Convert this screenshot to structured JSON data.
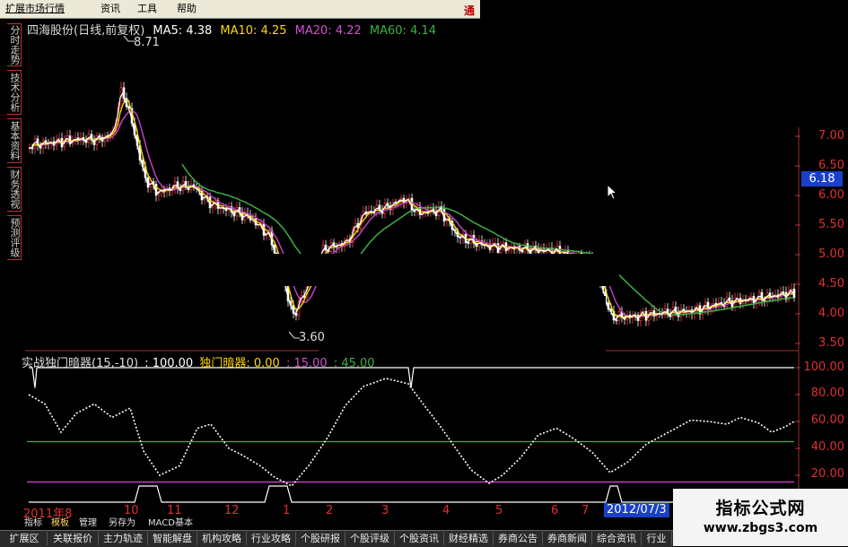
{
  "menu": {
    "items": [
      "扩展市场行情",
      "资讯",
      "工具",
      "帮助"
    ],
    "right_label": "通"
  },
  "side_tabs": [
    "分时走势",
    "技术分析",
    "基本资料",
    "财务透视",
    "预测评级"
  ],
  "price_chart": {
    "stock_title": "四海股份(日线,前复权)",
    "ma5_label": "MA5: 4.38",
    "ma10_label": "MA10: 4.25",
    "ma20_label": "MA20: 4.22",
    "ma60_label": "MA60: 4.14",
    "high_marker": "8.71",
    "low_marker": "3.60",
    "current_price": "6.18",
    "axis_labels": [
      "7.00",
      "6.50",
      "6.00",
      "5.50",
      "5.00",
      "4.50",
      "4.00",
      "3.50"
    ],
    "colors": {
      "ma5": "#ffffff",
      "ma10": "#ffd700",
      "ma20": "#c040c0",
      "ma60": "#3cb043",
      "candle_up": "#ff4040",
      "candle_down": "#ffffff"
    }
  },
  "indicator": {
    "name": "实战独门暗器(15,-10)",
    "value_label": ": 100.00",
    "line_label": "独门暗器: 0.00",
    "level_low": ": 15.00",
    "level_high": ": 45.00",
    "axis_labels": [
      "100.00",
      "80.00",
      "60.00",
      "40.00",
      "20.00"
    ],
    "colors": {
      "main": "#ffffff",
      "level_45": "#3cb043",
      "level_15": "#c040c0"
    }
  },
  "date_axis": {
    "ticks": [
      "2011年8",
      "10",
      "11",
      "12",
      "1",
      "2",
      "3",
      "4",
      "5",
      "6",
      "7"
    ],
    "selected_date": "2012/07/3"
  },
  "sub_tabs": [
    "指标",
    "模板",
    "管理",
    "另存为",
    "MACD基本"
  ],
  "bottom_tabs": [
    "扩展区",
    "关联报价",
    "主力轨迹",
    "智能解盘",
    "机构攻略",
    "行业攻略",
    "个股研报",
    "个股评级",
    "个股资讯",
    "财经精选",
    "券商公告",
    "券商新闻",
    "综合资讯",
    "行业"
  ],
  "watermark": {
    "title": "指标公式网",
    "url": "www.zbgs3.com"
  }
}
